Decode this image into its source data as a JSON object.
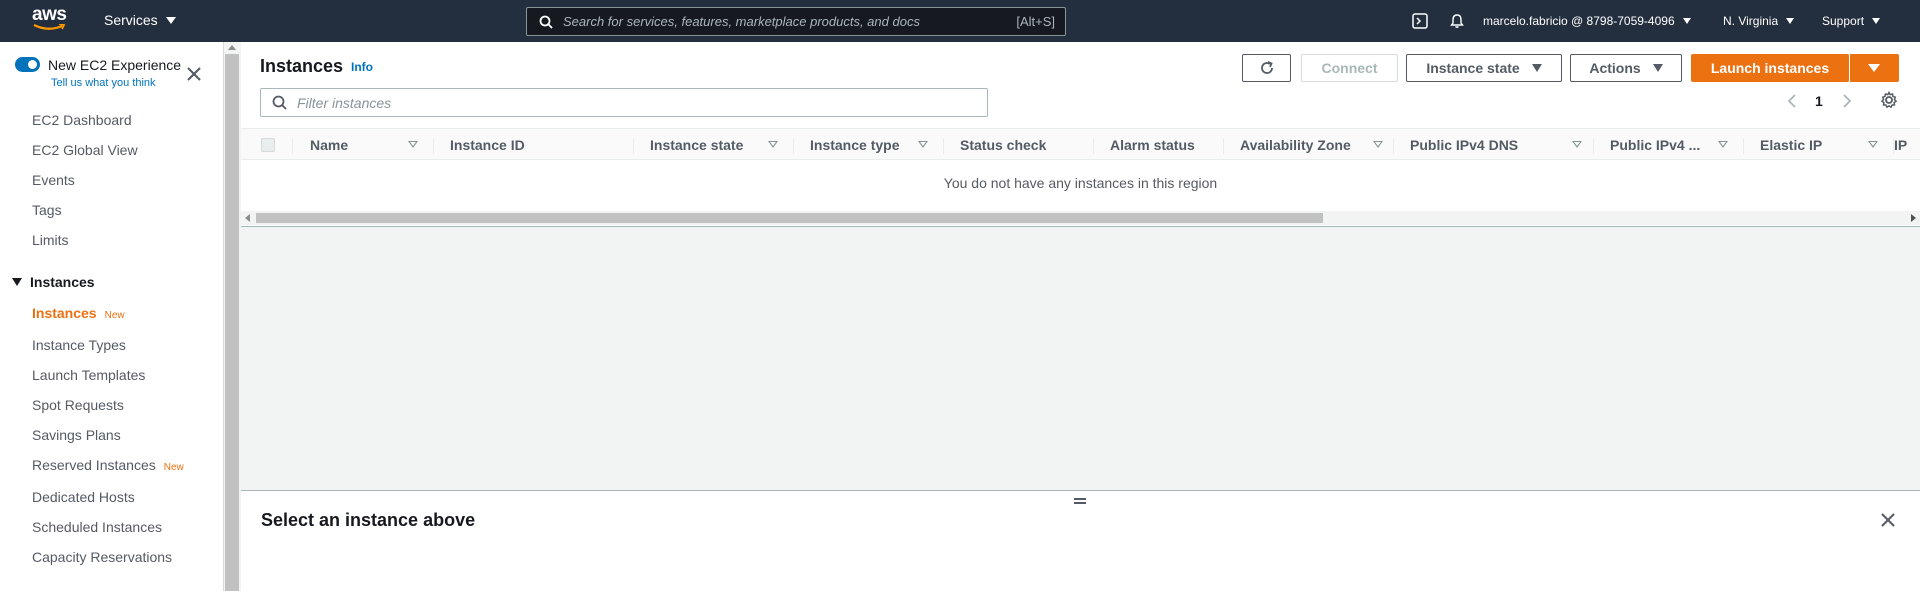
{
  "topnav": {
    "logo": "aws",
    "services_label": "Services",
    "search_placeholder": "Search for services, features, marketplace products, and docs",
    "search_shortcut": "[Alt+S]",
    "account_label": "marcelo.fabricio @ 8798-7059-4096",
    "region_label": "N. Virginia",
    "support_label": "Support"
  },
  "sidebar": {
    "new_experience_title": "New EC2 Experience",
    "new_experience_link": "Tell us what you think",
    "toggle_on": true,
    "top_items": [
      {
        "label": "EC2 Dashboard"
      },
      {
        "label": "EC2 Global View"
      },
      {
        "label": "Events"
      },
      {
        "label": "Tags"
      },
      {
        "label": "Limits"
      }
    ],
    "section_label": "Instances",
    "section_items": [
      {
        "label": "Instances",
        "badge": "New",
        "active": true
      },
      {
        "label": "Instance Types"
      },
      {
        "label": "Launch Templates"
      },
      {
        "label": "Spot Requests"
      },
      {
        "label": "Savings Plans"
      },
      {
        "label": "Reserved Instances",
        "badge": "New"
      },
      {
        "label": "Dedicated Hosts"
      },
      {
        "label": "Scheduled Instances"
      },
      {
        "label": "Capacity Reservations"
      }
    ]
  },
  "main": {
    "title": "Instances",
    "info_link": "Info",
    "buttons": {
      "connect": "Connect",
      "instance_state": "Instance state",
      "actions": "Actions",
      "launch": "Launch instances"
    },
    "filter_placeholder": "Filter instances",
    "page_number": "1",
    "columns": [
      {
        "label": "Name"
      },
      {
        "label": "Instance ID"
      },
      {
        "label": "Instance state"
      },
      {
        "label": "Instance type"
      },
      {
        "label": "Status check"
      },
      {
        "label": "Alarm status"
      },
      {
        "label": "Availability Zone"
      },
      {
        "label": "Public IPv4 DNS"
      },
      {
        "label": "Public IPv4 ..."
      },
      {
        "label": "Elastic IP"
      },
      {
        "label": "IP"
      }
    ],
    "empty_message": "You do not have any instances in this region",
    "detail_title": "Select an instance above"
  },
  "colors": {
    "nav_bg": "#232f3e",
    "accent_orange": "#ec7211",
    "link_blue": "#0073bb"
  }
}
